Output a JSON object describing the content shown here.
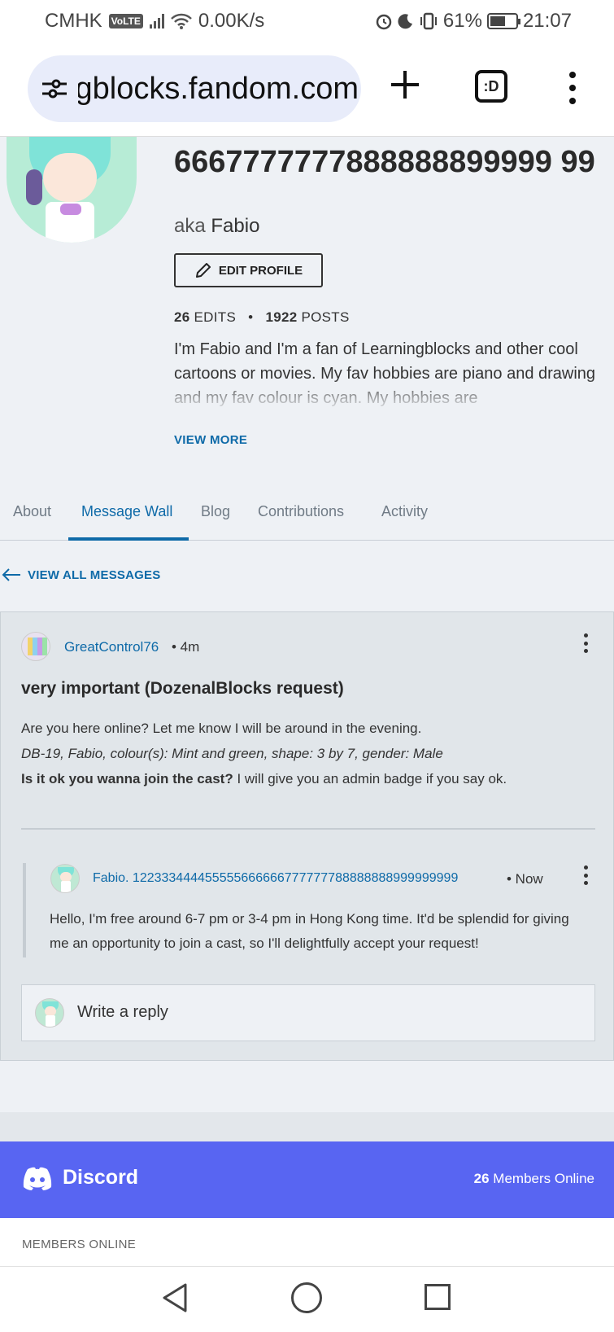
{
  "status_bar": {
    "carrier": "CMHK",
    "volte": "VoLTE",
    "speed": "0.00K/s",
    "battery": "61%",
    "battery_level": 0.61,
    "time": "21:07"
  },
  "browser": {
    "url": "learningblocks.fandom.com",
    "icons": [
      "tune-icon",
      "plus-icon",
      "tab-switcher-icon",
      "more-vert-icon"
    ],
    "tab_switcher_label": ":D"
  },
  "profile": {
    "username": "6667777777888888899999 99",
    "aka_label": "aka",
    "aka_name": "Fabio",
    "edit_button": "EDIT PROFILE",
    "edits_count": "26",
    "edits_label": "EDITS",
    "separator": "•",
    "posts_count": "1922",
    "posts_label": "POSTS",
    "bio": "I'm Fabio and I'm a fan of Learningblocks and other cool cartoons or movies. My fav hobbies are piano and drawing and my fav colour is cyan. My hobbies are",
    "view_more": "VIEW MORE"
  },
  "tabs": [
    {
      "label": "About"
    },
    {
      "label": "Message Wall"
    },
    {
      "label": "Blog"
    },
    {
      "label": "Contributions"
    },
    {
      "label": "Activity"
    }
  ],
  "active_tab": "Message Wall",
  "view_all_messages": "VIEW ALL MESSAGES",
  "message": {
    "author": "GreatControl76",
    "time": "• 4m",
    "title": "very important (DozenalBlocks request)",
    "line1": "Are you here online? Let me know I will be around in the evening.",
    "line2": "DB-19, Fabio, colour(s): Mint and green, shape: 3 by 7, gender: Male",
    "line3_bold": "Is it ok you wanna join the cast?",
    "line3_rest": " I will give you an admin badge if you say ok.",
    "reply": {
      "author": "Fabio. 122333444455555666666777777788888888999999999",
      "time": "• Now",
      "text": "Hello, I'm free around 6-7 pm or 3-4 pm in Hong Kong time. It'd be splendid for giving me an opportunity to join a cast, so I'll delightfully accept your request!"
    },
    "write_reply": "Write a reply"
  },
  "discord": {
    "name": "Discord",
    "members_count": "26",
    "members_label": " Members Online",
    "members_online_header": "MEMBERS ONLINE",
    "color": "#5865f2"
  },
  "colors": {
    "link": "#0e6aa8",
    "background": "#eef1f5"
  }
}
